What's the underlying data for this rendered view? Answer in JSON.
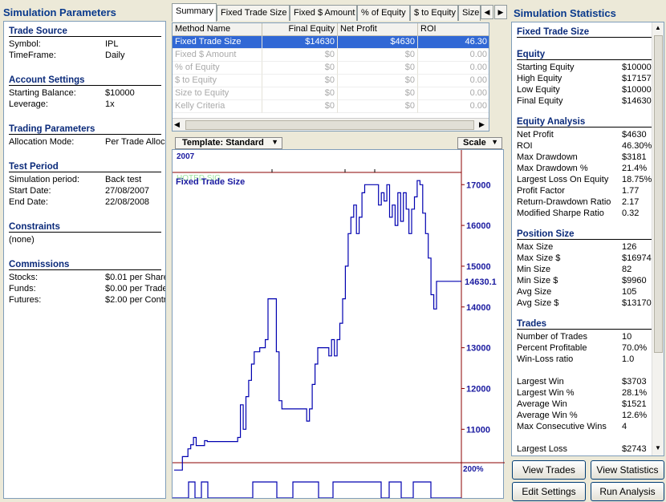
{
  "left": {
    "title": "Simulation Parameters",
    "sections": [
      {
        "title": "Trade Source",
        "rows": [
          [
            "Symbol:",
            "IPL"
          ],
          [
            "TimeFrame:",
            "Daily"
          ]
        ]
      },
      {
        "title": "Account Settings",
        "rows": [
          [
            "Starting Balance:",
            "$10000"
          ],
          [
            "Leverage:",
            "1x"
          ]
        ]
      },
      {
        "title": "Trading Parameters",
        "rows": [
          [
            "Allocation Mode:",
            "Per Trade Alloc"
          ]
        ]
      },
      {
        "title": "Test Period",
        "rows": [
          [
            "Simulation period:",
            "Back test"
          ],
          [
            "Start Date:",
            "27/08/2007"
          ],
          [
            "End Date:",
            "22/08/2008"
          ]
        ]
      },
      {
        "title": "Constraints",
        "rows": [
          [
            "(none)",
            ""
          ]
        ]
      },
      {
        "title": "Commissions",
        "rows": [
          [
            "Stocks:",
            "$0.01 per Share"
          ],
          [
            "Funds:",
            "$0.00 per Trade"
          ],
          [
            "Futures:",
            "$2.00 per Contr"
          ]
        ]
      }
    ]
  },
  "tabs": [
    "Summary",
    "Fixed Trade Size",
    "Fixed $ Amount",
    "% of Equity",
    "$ to Equity",
    "Size"
  ],
  "grid": {
    "headers": [
      "Method Name",
      "Final Equity",
      "Net Profit",
      "ROI"
    ],
    "rows": [
      [
        "Fixed Trade Size",
        "$14630",
        "$4630",
        "46.30"
      ],
      [
        "Fixed $ Amount",
        "$0",
        "$0",
        "0.00"
      ],
      [
        "% of Equity",
        "$0",
        "$0",
        "0.00"
      ],
      [
        "$ to Equity",
        "$0",
        "$0",
        "0.00"
      ],
      [
        "Size to Equity",
        "$0",
        "$0",
        "0.00"
      ],
      [
        "Kelly Criteria",
        "$0",
        "$0",
        "0.00"
      ]
    ]
  },
  "chart_toolbar": {
    "template": "Template: Standard",
    "scale": "Scale"
  },
  "chart": {
    "year": "2007",
    "watermark": "HOTED SIG",
    "series_label": "Fixed Trade Size",
    "last_value_label": "14630.1",
    "lower_label": "200%",
    "colors": {
      "line": "#0000b0",
      "frame": "#8b0000",
      "label": "#1a1aa0"
    }
  },
  "chart_data": {
    "type": "line",
    "title": "",
    "series": [
      {
        "name": "Fixed Trade Size",
        "values": [
          10000,
          10000,
          10000,
          10330,
          10330,
          10520,
          10620,
          10800,
          10600,
          10600,
          10600,
          10720,
          10700,
          10700,
          10700,
          10700,
          10700,
          10700,
          10700,
          10700,
          10700,
          10700,
          10700,
          10800,
          11600,
          11000,
          11800,
          12200,
          12600,
          12900,
          12900,
          13000,
          13000,
          13200,
          14200,
          14200,
          14200,
          12900,
          11700,
          11500,
          11500,
          11500,
          11500,
          11500,
          11500,
          11500,
          11500,
          11500,
          11200,
          11500,
          12100,
          12600,
          13000,
          13000,
          13000,
          13000,
          12800,
          13200,
          12800,
          13200,
          13600,
          14200,
          15000,
          15800,
          16200,
          16500,
          15800,
          16200,
          16800,
          17000,
          17000,
          17000,
          17000,
          17000,
          16500,
          16800,
          16600,
          17000,
          16200,
          16500,
          16000,
          16800,
          16100,
          16800,
          16400,
          15800,
          16400,
          16700,
          17100,
          17000,
          16300,
          15800,
          15200,
          14300,
          13950,
          14630,
          14630,
          14630,
          14630,
          14630,
          14630,
          14630,
          14630,
          14630,
          14630
        ]
      }
    ],
    "ylabel": "",
    "yticks": [
      17000,
      16000,
      15000,
      14000,
      13000,
      12000,
      11000
    ],
    "ylim": [
      10180,
      17300
    ],
    "grid": false
  },
  "right": {
    "title": "Simulation Statistics",
    "sections": [
      {
        "title": "Fixed Trade Size",
        "rows": []
      },
      {
        "title": "Equity",
        "rows": [
          [
            "Starting Equity",
            "$10000"
          ],
          [
            "High Equity",
            "$17157"
          ],
          [
            "Low Equity",
            "$10000"
          ],
          [
            "Final Equity",
            "$14630"
          ]
        ]
      },
      {
        "title": "Equity Analysis",
        "rows": [
          [
            "Net Profit",
            "$4630"
          ],
          [
            "ROI",
            "46.30%"
          ],
          [
            "Max Drawdown",
            "$3181"
          ],
          [
            "Max Drawdown %",
            "21.4%"
          ],
          [
            "Largest Loss On Equity",
            "18.75%"
          ],
          [
            "Profit Factor",
            "1.77"
          ],
          [
            "Return-Drawdown Ratio",
            "2.17"
          ],
          [
            "Modified Sharpe Ratio",
            "0.32"
          ]
        ]
      },
      {
        "title": "Position Size",
        "rows": [
          [
            "Max Size",
            "126"
          ],
          [
            "Max Size $",
            "$16974"
          ],
          [
            "Min Size",
            "82"
          ],
          [
            "Min Size $",
            "$9960"
          ],
          [
            "Avg Size",
            "105"
          ],
          [
            "Avg Size $",
            "$13170"
          ]
        ]
      },
      {
        "title": "Trades",
        "rows": [
          [
            "Number of Trades",
            "10"
          ],
          [
            "Percent Profitable",
            "70.0%"
          ],
          [
            "Win-Loss ratio",
            "1.0"
          ],
          [
            "",
            ""
          ],
          [
            "Largest Win",
            "$3703"
          ],
          [
            "Largest Win %",
            "28.1%"
          ],
          [
            "Average Win",
            "$1521"
          ],
          [
            "Average Win %",
            "12.6%"
          ],
          [
            "Max Consecutive Wins",
            "4"
          ],
          [
            "",
            ""
          ],
          [
            "Largest Loss",
            "$2743"
          ]
        ]
      }
    ]
  },
  "buttons": {
    "view_trades": "View Trades",
    "view_statistics": "View Statistics",
    "edit_settings": "Edit Settings",
    "run_analysis": "Run Analysis"
  }
}
